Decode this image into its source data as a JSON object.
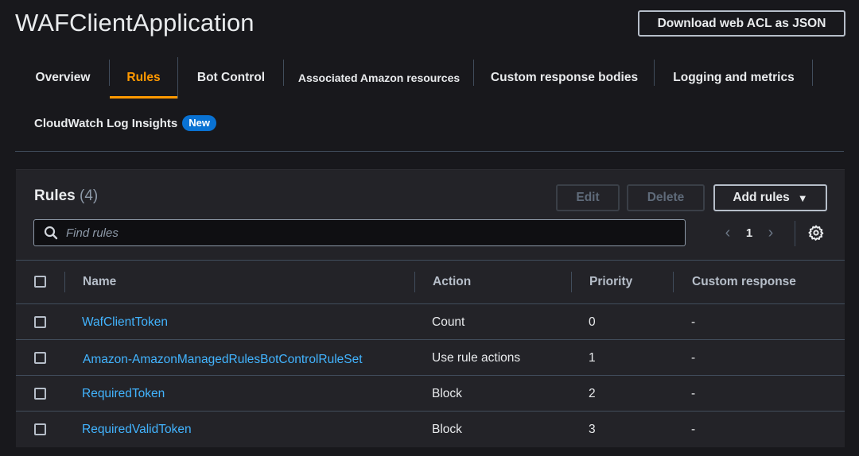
{
  "header": {
    "title": "WAFClientApplication",
    "download_label": "Download web ACL as JSON"
  },
  "tabs": [
    {
      "label": "Overview",
      "active": false
    },
    {
      "label": "Rules",
      "active": true
    },
    {
      "label": "Bot Control",
      "active": false
    },
    {
      "label": "Associated Amazon resources",
      "active": false
    },
    {
      "label": "Custom response bodies",
      "active": false
    },
    {
      "label": "Logging and metrics",
      "active": false
    },
    {
      "label": "CloudWatch Log Insights",
      "active": false,
      "badge": "New"
    }
  ],
  "rules_panel": {
    "heading": "Rules",
    "count": "(4)",
    "edit_label": "Edit",
    "delete_label": "Delete",
    "add_label": "Add rules",
    "search_placeholder": "Find rules",
    "current_page": "1"
  },
  "table": {
    "columns": [
      "Name",
      "Action",
      "Priority",
      "Custom response"
    ],
    "rows": [
      {
        "name": "WafClientToken",
        "action": "Count",
        "priority": "0",
        "custom_response": "-"
      },
      {
        "name": "Amazon-AmazonManagedRulesBotControlRuleSet",
        "action": "Use rule actions",
        "priority": "1",
        "custom_response": "-"
      },
      {
        "name": "RequiredToken",
        "action": "Block",
        "priority": "2",
        "custom_response": "-"
      },
      {
        "name": "RequiredValidToken",
        "action": "Block",
        "priority": "3",
        "custom_response": "-"
      }
    ]
  },
  "colors": {
    "background": "#18181c",
    "panel": "#232328",
    "accent_active_tab": "#ff9900",
    "link": "#42b4ff",
    "badge": "#0972d3"
  }
}
